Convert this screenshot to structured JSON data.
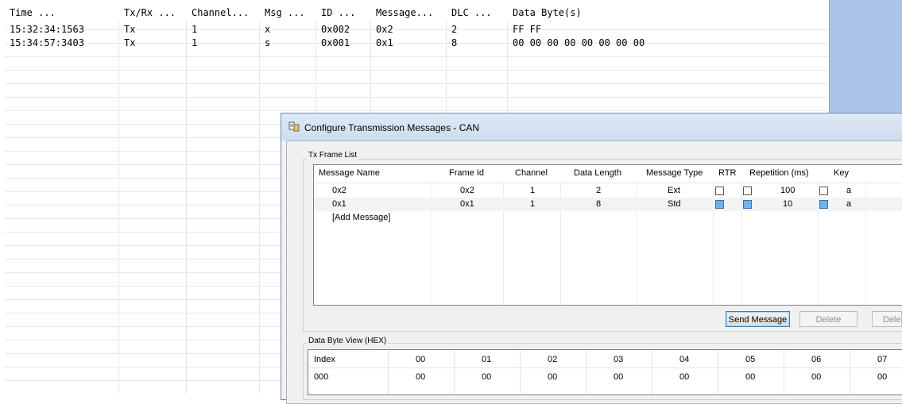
{
  "trace": {
    "columns": [
      "Time         ...",
      "Tx/Rx ...",
      "Channel...",
      "Msg ...",
      "ID  ...",
      "Message...",
      "DLC  ...",
      "Data Byte(s)"
    ],
    "rows": [
      [
        "15:32:34:1563",
        "Tx",
        "1",
        "x",
        "0x002",
        "0x2",
        "2",
        "FF FF"
      ],
      [
        "15:34:57:3403",
        "Tx",
        "1",
        "s",
        "0x001",
        "0x1",
        "8",
        "00 00 00 00 00 00 00 00"
      ]
    ]
  },
  "dialog": {
    "title": "Configure Transmission Messages - CAN",
    "tx_frame_list_label": "Tx Frame List",
    "columns": [
      "Message Name",
      "Frame Id",
      "Channel",
      "Data Length",
      "Message Type",
      "RTR",
      "Repetition (ms)",
      "Key"
    ],
    "rows": [
      {
        "name": "0x2",
        "frame_id": "0x2",
        "channel": "1",
        "data_length": "2",
        "message_type": "Ext",
        "rtr": false,
        "rep_enabled": false,
        "repetition": "100",
        "key_enabled": false,
        "key": "a"
      },
      {
        "name": "0x1",
        "frame_id": "0x1",
        "channel": "1",
        "data_length": "8",
        "message_type": "Std",
        "rtr": true,
        "rep_enabled": true,
        "repetition": "10",
        "key_enabled": true,
        "key": "a"
      }
    ],
    "add_message_label": "[Add Message]",
    "buttons": {
      "send": "Send Message",
      "delete": "Delete",
      "delete_all": "Delet"
    },
    "data_byte_view_label": "Data Byte View (HEX)",
    "hex": {
      "header": [
        "Index",
        "00",
        "01",
        "02",
        "03",
        "04",
        "05",
        "06",
        "07"
      ],
      "row": [
        "000",
        "00",
        "00",
        "00",
        "00",
        "00",
        "00",
        "00",
        "00"
      ]
    }
  },
  "colors": {
    "desktop_strip": "#a9c4e8",
    "checkbox_checked": "#6fb3f0",
    "title_bar": "#dfe9f5"
  }
}
